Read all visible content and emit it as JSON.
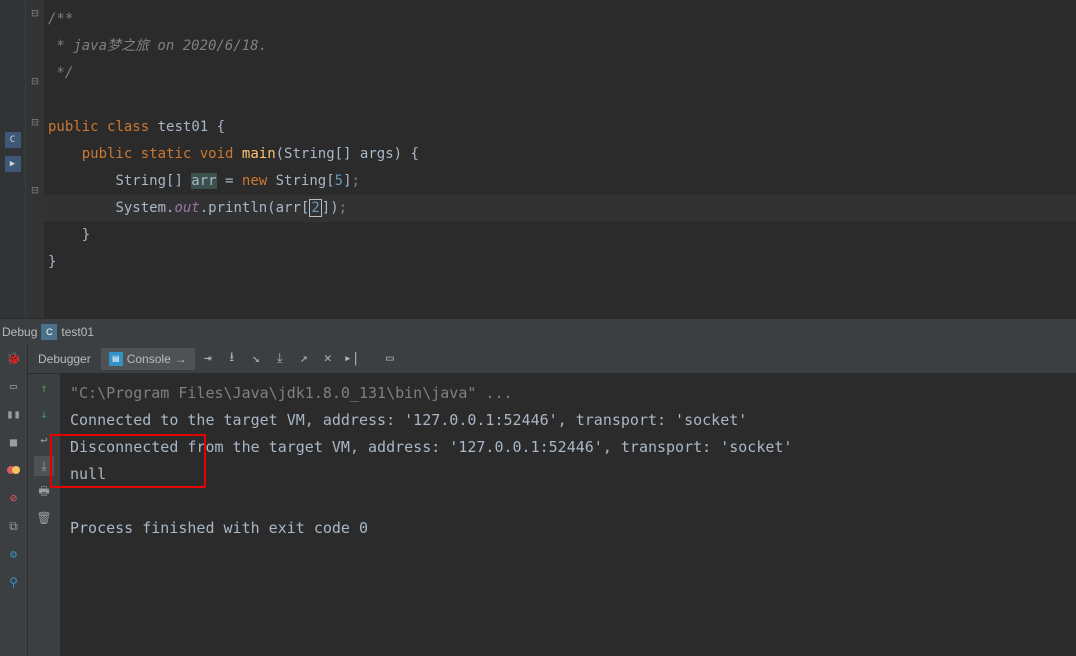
{
  "code": {
    "l1": "/**",
    "l2": " * java梦之旅 on 2020/6/18.",
    "l3": " */",
    "kw_public": "public",
    "kw_class": "class",
    "class_name": "test01",
    "kw_static": "static",
    "kw_void": "void",
    "fn_main": "main",
    "params_text": "(String[] args) {",
    "line6_a": "String[] ",
    "line6_var": "arr",
    "line6_b": " = ",
    "kw_new": "new",
    "line6_c": " String[",
    "num5": "5",
    "line6_d": "]",
    "semi": ";",
    "line7_a": "System.",
    "out_field": "out",
    "line7_b": ".println(arr[",
    "num2": "2",
    "line7_c": "])",
    "close_brace": "}"
  },
  "debug": {
    "title": "Debug",
    "run_config": "test01",
    "tabs": {
      "debugger": "Debugger",
      "console": "Console"
    }
  },
  "console": {
    "cmd": "\"C:\\Program Files\\Java\\jdk1.8.0_131\\bin\\java\" ...",
    "connected": "Connected to the target VM, address: '127.0.0.1:52446', transport: 'socket'",
    "disconnected": "Disconnected from the target VM, address: '127.0.0.1:52446', transport: 'socket'",
    "null_out": "null",
    "exit": "Process finished with exit code 0"
  }
}
